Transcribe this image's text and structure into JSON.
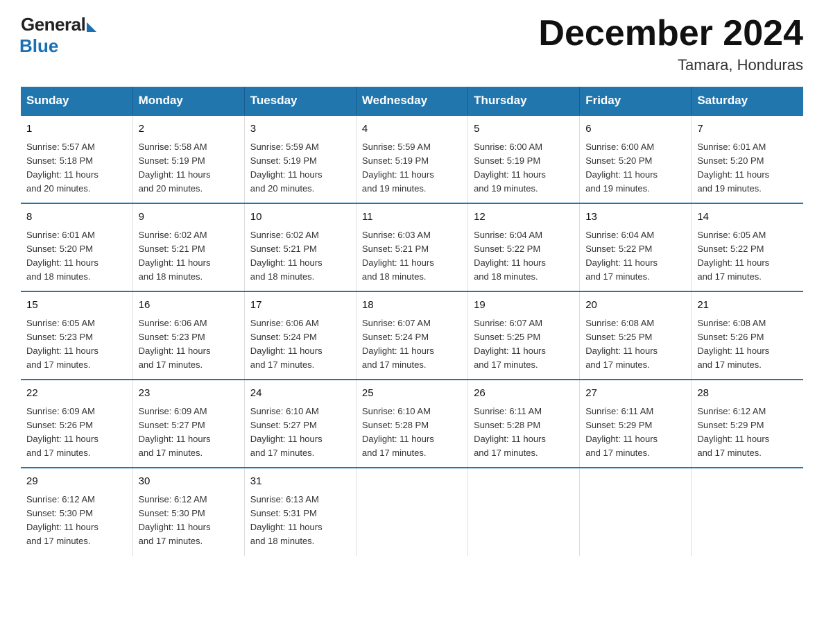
{
  "logo": {
    "general": "General",
    "blue": "Blue"
  },
  "title": "December 2024",
  "location": "Tamara, Honduras",
  "days_header": [
    "Sunday",
    "Monday",
    "Tuesday",
    "Wednesday",
    "Thursday",
    "Friday",
    "Saturday"
  ],
  "weeks": [
    [
      {
        "day": "1",
        "sunrise": "5:57 AM",
        "sunset": "5:18 PM",
        "daylight": "11 hours and 20 minutes."
      },
      {
        "day": "2",
        "sunrise": "5:58 AM",
        "sunset": "5:19 PM",
        "daylight": "11 hours and 20 minutes."
      },
      {
        "day": "3",
        "sunrise": "5:59 AM",
        "sunset": "5:19 PM",
        "daylight": "11 hours and 20 minutes."
      },
      {
        "day": "4",
        "sunrise": "5:59 AM",
        "sunset": "5:19 PM",
        "daylight": "11 hours and 19 minutes."
      },
      {
        "day": "5",
        "sunrise": "6:00 AM",
        "sunset": "5:19 PM",
        "daylight": "11 hours and 19 minutes."
      },
      {
        "day": "6",
        "sunrise": "6:00 AM",
        "sunset": "5:20 PM",
        "daylight": "11 hours and 19 minutes."
      },
      {
        "day": "7",
        "sunrise": "6:01 AM",
        "sunset": "5:20 PM",
        "daylight": "11 hours and 19 minutes."
      }
    ],
    [
      {
        "day": "8",
        "sunrise": "6:01 AM",
        "sunset": "5:20 PM",
        "daylight": "11 hours and 18 minutes."
      },
      {
        "day": "9",
        "sunrise": "6:02 AM",
        "sunset": "5:21 PM",
        "daylight": "11 hours and 18 minutes."
      },
      {
        "day": "10",
        "sunrise": "6:02 AM",
        "sunset": "5:21 PM",
        "daylight": "11 hours and 18 minutes."
      },
      {
        "day": "11",
        "sunrise": "6:03 AM",
        "sunset": "5:21 PM",
        "daylight": "11 hours and 18 minutes."
      },
      {
        "day": "12",
        "sunrise": "6:04 AM",
        "sunset": "5:22 PM",
        "daylight": "11 hours and 18 minutes."
      },
      {
        "day": "13",
        "sunrise": "6:04 AM",
        "sunset": "5:22 PM",
        "daylight": "11 hours and 17 minutes."
      },
      {
        "day": "14",
        "sunrise": "6:05 AM",
        "sunset": "5:22 PM",
        "daylight": "11 hours and 17 minutes."
      }
    ],
    [
      {
        "day": "15",
        "sunrise": "6:05 AM",
        "sunset": "5:23 PM",
        "daylight": "11 hours and 17 minutes."
      },
      {
        "day": "16",
        "sunrise": "6:06 AM",
        "sunset": "5:23 PM",
        "daylight": "11 hours and 17 minutes."
      },
      {
        "day": "17",
        "sunrise": "6:06 AM",
        "sunset": "5:24 PM",
        "daylight": "11 hours and 17 minutes."
      },
      {
        "day": "18",
        "sunrise": "6:07 AM",
        "sunset": "5:24 PM",
        "daylight": "11 hours and 17 minutes."
      },
      {
        "day": "19",
        "sunrise": "6:07 AM",
        "sunset": "5:25 PM",
        "daylight": "11 hours and 17 minutes."
      },
      {
        "day": "20",
        "sunrise": "6:08 AM",
        "sunset": "5:25 PM",
        "daylight": "11 hours and 17 minutes."
      },
      {
        "day": "21",
        "sunrise": "6:08 AM",
        "sunset": "5:26 PM",
        "daylight": "11 hours and 17 minutes."
      }
    ],
    [
      {
        "day": "22",
        "sunrise": "6:09 AM",
        "sunset": "5:26 PM",
        "daylight": "11 hours and 17 minutes."
      },
      {
        "day": "23",
        "sunrise": "6:09 AM",
        "sunset": "5:27 PM",
        "daylight": "11 hours and 17 minutes."
      },
      {
        "day": "24",
        "sunrise": "6:10 AM",
        "sunset": "5:27 PM",
        "daylight": "11 hours and 17 minutes."
      },
      {
        "day": "25",
        "sunrise": "6:10 AM",
        "sunset": "5:28 PM",
        "daylight": "11 hours and 17 minutes."
      },
      {
        "day": "26",
        "sunrise": "6:11 AM",
        "sunset": "5:28 PM",
        "daylight": "11 hours and 17 minutes."
      },
      {
        "day": "27",
        "sunrise": "6:11 AM",
        "sunset": "5:29 PM",
        "daylight": "11 hours and 17 minutes."
      },
      {
        "day": "28",
        "sunrise": "6:12 AM",
        "sunset": "5:29 PM",
        "daylight": "11 hours and 17 minutes."
      }
    ],
    [
      {
        "day": "29",
        "sunrise": "6:12 AM",
        "sunset": "5:30 PM",
        "daylight": "11 hours and 17 minutes."
      },
      {
        "day": "30",
        "sunrise": "6:12 AM",
        "sunset": "5:30 PM",
        "daylight": "11 hours and 17 minutes."
      },
      {
        "day": "31",
        "sunrise": "6:13 AM",
        "sunset": "5:31 PM",
        "daylight": "11 hours and 18 minutes."
      },
      null,
      null,
      null,
      null
    ]
  ],
  "labels": {
    "sunrise": "Sunrise:",
    "sunset": "Sunset:",
    "daylight": "Daylight:"
  }
}
